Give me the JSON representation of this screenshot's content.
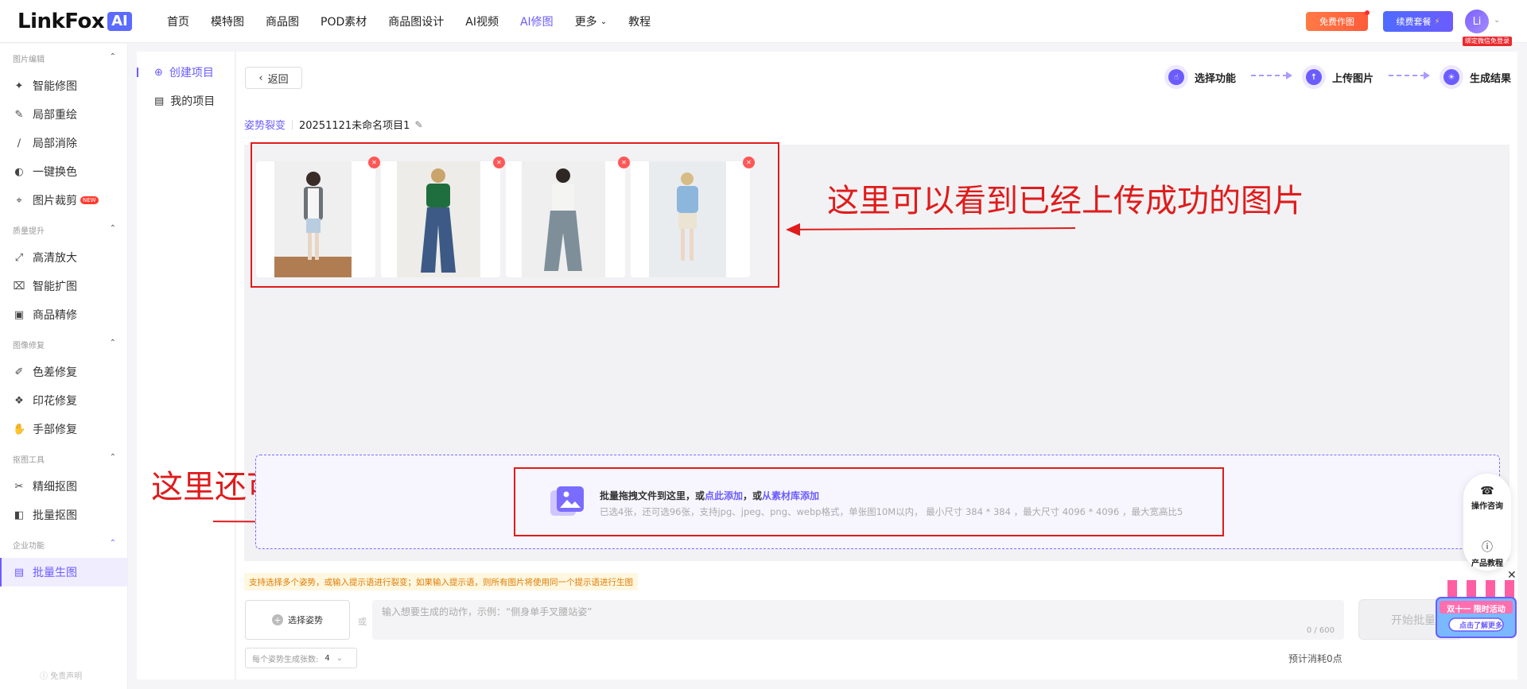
{
  "header": {
    "logo_text": "LinkFox",
    "logo_badge": "AI",
    "nav": [
      {
        "label": "首页"
      },
      {
        "label": "模特图"
      },
      {
        "label": "商品图"
      },
      {
        "label": "POD素材"
      },
      {
        "label": "商品图设计"
      },
      {
        "label": "AI视频"
      },
      {
        "label": "AI修图",
        "active": true
      },
      {
        "label": "更多"
      },
      {
        "label": "教程"
      }
    ],
    "free_button": "免费作图",
    "renew_button": "续费套餐",
    "avatar_text": "Li",
    "avatar_badge": "绑定微信免登录",
    "accent_color": "#6b5cff"
  },
  "sidebar": {
    "sections": [
      {
        "title": "图片编辑",
        "items": [
          "智能修图",
          "局部重绘",
          "局部消除",
          "一键换色",
          "图片裁剪"
        ]
      },
      {
        "title": "质量提升",
        "items": [
          "高清放大",
          "智能扩图",
          "商品精修"
        ]
      },
      {
        "title": "图像修复",
        "items": [
          "色差修复",
          "印花修复",
          "手部修复"
        ]
      },
      {
        "title": "抠图工具",
        "items": [
          "精细抠图",
          "批量抠图"
        ]
      },
      {
        "title": "企业功能",
        "items": [
          "批量生图"
        ]
      }
    ],
    "new_badge": "NEW",
    "disclaimer": "免责声明"
  },
  "projects": {
    "create": "创建项目",
    "mine": "我的项目"
  },
  "main": {
    "back": "返回",
    "steps": [
      "选择功能",
      "上传图片",
      "生成结果"
    ],
    "crumb_type": "姿势裂变",
    "project_name": "20251121未命名项目1",
    "images_count": 4,
    "annotation_top": "这里可以看到已经上传成功的图片",
    "annotation_bottom": "这里还可以继续添加图片",
    "drop_line1_a": "批量拖拽文件到这里，或",
    "drop_link1": "点此添加",
    "drop_line1_b": "，或",
    "drop_link2": "从素材库添加",
    "drop_line2": "已选4张，还可选96张，支持jpg、jpeg、png、webp格式，单张图10M以内， 最小尺寸 384 * 384 ，最大尺寸 4096 * 4096 ，最大宽高比5",
    "tip": "支持选择多个姿势，或输入提示语进行裂变；如果输入提示语，则所有图片将使用同一个提示语进行生图",
    "select_pose": "选择姿势",
    "or": "或",
    "prompt_placeholder": "输入想要生成的动作，示例：“侧身单手叉腰站姿”",
    "prompt_count": "0 / 600",
    "start_button": "开始批量",
    "count_label": "每个姿势生成张数:",
    "count_value": "4",
    "est_cost": "预计消耗0点"
  },
  "floating": {
    "consult": "操作咨询",
    "tutorial": "产品教程",
    "promo_title": "双十一 限时活动",
    "promo_button": "点击了解更多"
  }
}
